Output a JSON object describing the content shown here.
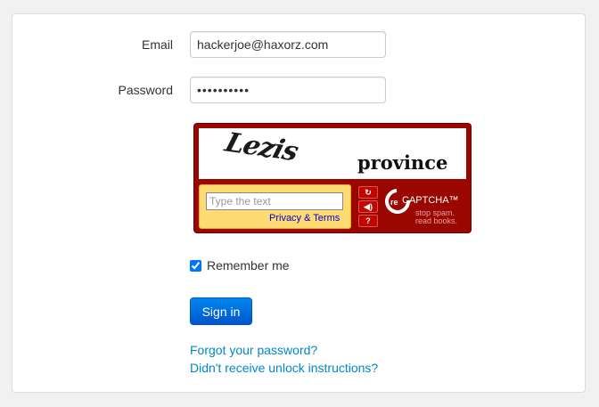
{
  "form": {
    "email_label": "Email",
    "email_value": "hackerjoe@haxorz.com",
    "password_label": "Password",
    "password_value": "••••••••••",
    "remember_label": "Remember me",
    "remember_checked": true,
    "signin_label": "Sign in",
    "forgot_link": "Forgot your password?",
    "unlock_link": "Didn't receive unlock instructions?"
  },
  "captcha": {
    "word1": "Lezis",
    "word2": "province",
    "input_placeholder": "Type the text",
    "privacy_link": "Privacy & Terms",
    "reload_icon": "reload-icon",
    "audio_icon": "audio-icon",
    "help_icon": "help-icon",
    "logo_re": "re",
    "brand": "CAPTCHA™",
    "tagline_1": "stop spam.",
    "tagline_2": "read books."
  },
  "colors": {
    "captcha_red": "#9a0700",
    "captcha_yellow": "#ffdc73",
    "link_blue": "#0088cc",
    "button_blue": "#0066dd"
  }
}
